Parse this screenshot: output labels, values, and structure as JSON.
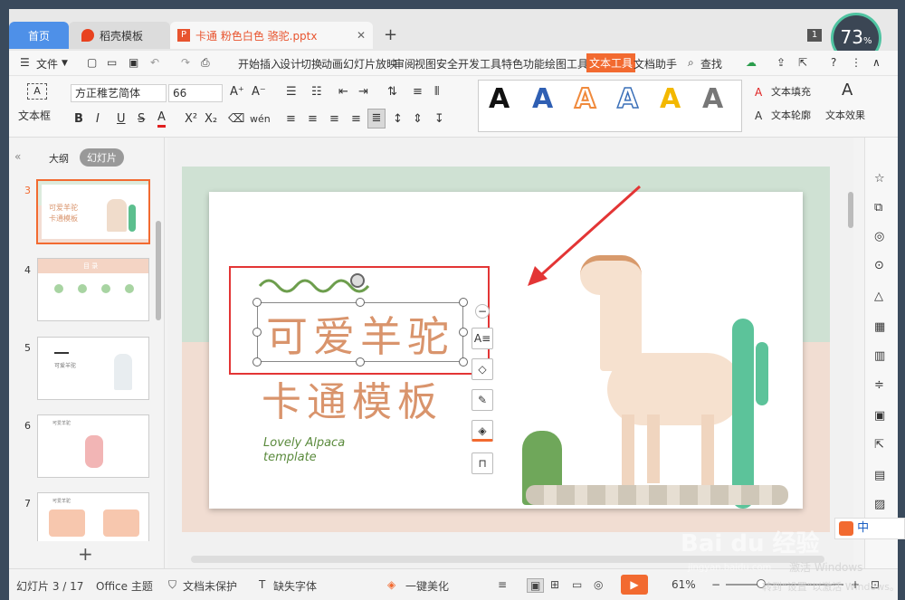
{
  "tabs": {
    "home": "首页",
    "docer": "稻壳模板",
    "file": "卡通 粉色白色 骆驼.pptx",
    "add": "+"
  },
  "perf": {
    "value": "73",
    "unit": "%"
  },
  "page_badge": "1",
  "menu": {
    "file": "文件",
    "items": [
      "开始",
      "插入",
      "设计",
      "切换",
      "动画",
      "幻灯片放映",
      "审阅",
      "视图",
      "安全",
      "开发工具",
      "特色功能",
      "绘图工具",
      "文本工具",
      "文档助手"
    ],
    "search": "查找"
  },
  "ribbon": {
    "textbox": "文本框",
    "font": "方正稚艺简体",
    "size": "66",
    "fill": "文本填充",
    "outline": "文本轮廓",
    "effect": "文本效果",
    "bold": "B",
    "italic": "I",
    "underline": "U",
    "strike": "S"
  },
  "sidebar": {
    "outline": "大纲",
    "slides": "幻灯片",
    "numbers": [
      "3",
      "4",
      "5",
      "6",
      "7"
    ],
    "thumb3_title": "可爱羊驼",
    "thumb3_sub": "卡通模板",
    "thumb4_title": "目 录",
    "thumb5_text": "可爱羊驼",
    "thumb6_text": "可爱羊驼",
    "thumb7_text": "可爱羊驼",
    "add": "+"
  },
  "slide": {
    "title": "可爱羊驼",
    "subtitle": "卡通模板",
    "en_line1": "Lovely Alpaca",
    "en_line2": "template"
  },
  "status": {
    "slide_info": "幻灯片 3 / 17",
    "theme": "Office 主题",
    "protect": "文档未保护",
    "font_missing": "缺失字体",
    "beautify": "一键美化",
    "zoom": "61%"
  },
  "watermark": {
    "line1": "激活 Windows",
    "line2": "转到“设置”以激活 Windows。",
    "site": "jingyan.baidu.com",
    "brand": "Bai du 经验",
    "ime": "中"
  },
  "colors": {
    "accent": "#f26a30",
    "tab_blue": "#4e90e8",
    "arrow": "#e33535",
    "title_text": "#d9946c",
    "green_text": "#5a8a3c"
  }
}
